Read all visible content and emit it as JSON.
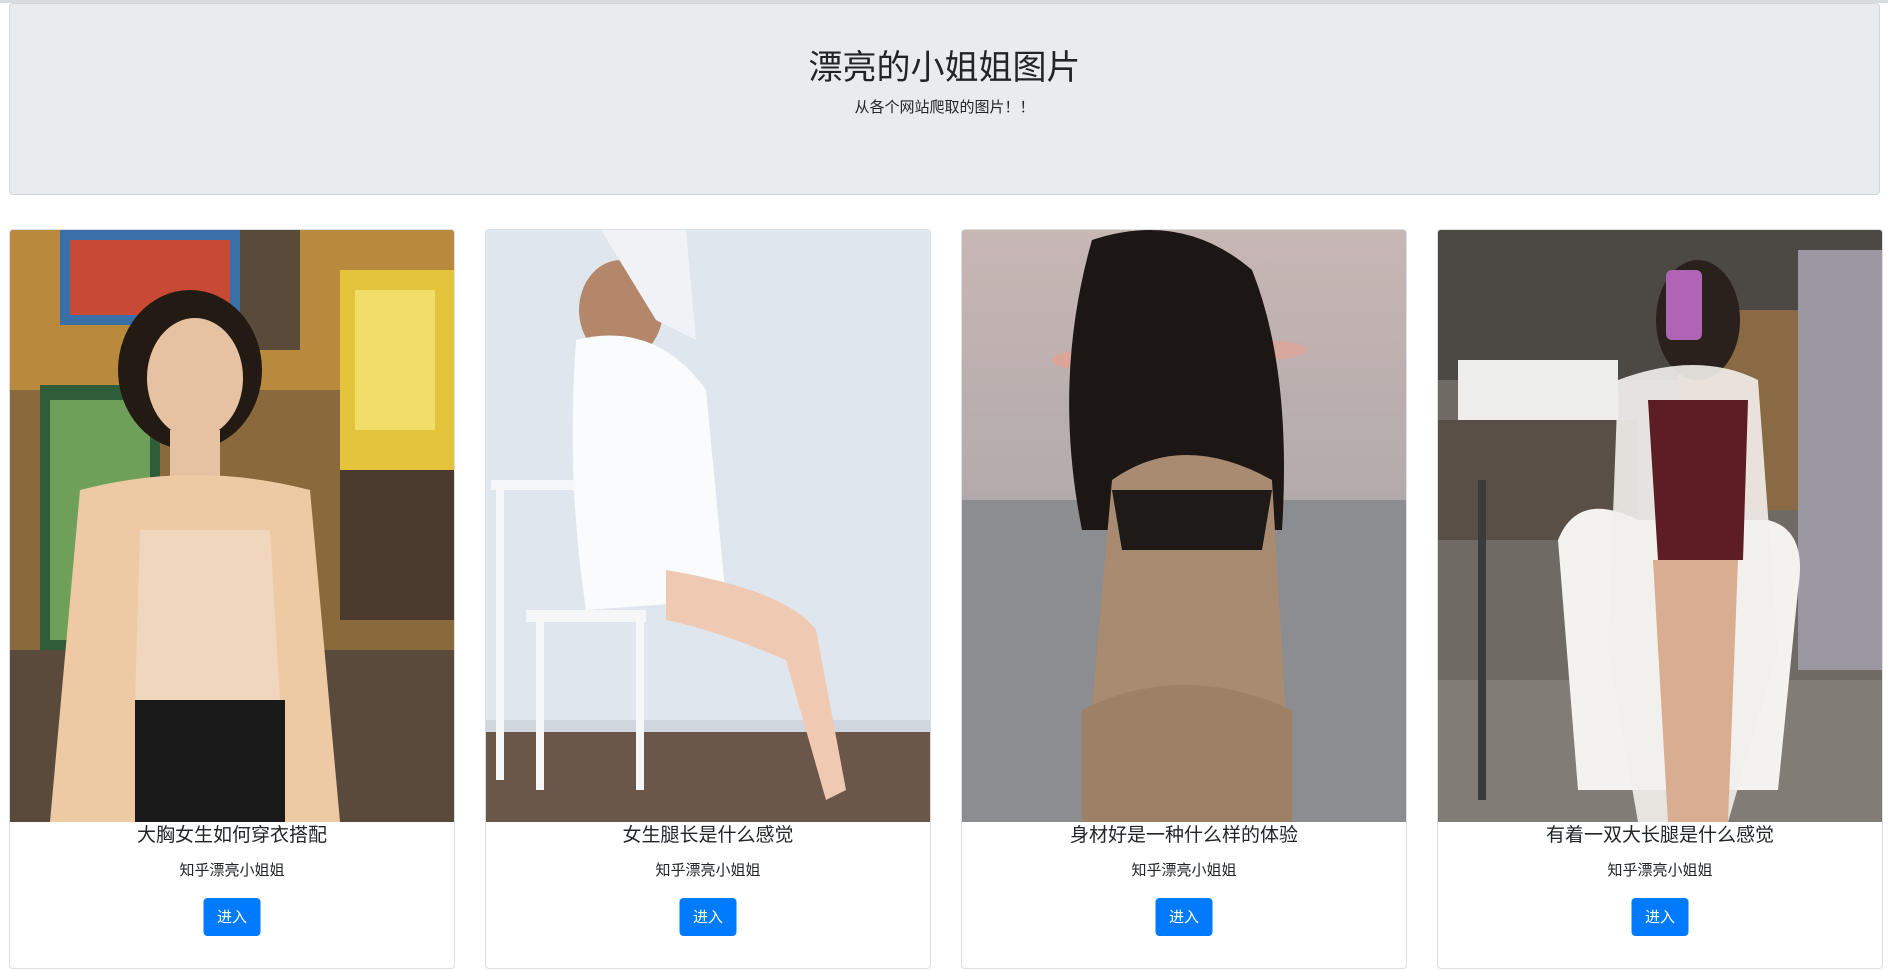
{
  "header": {
    "title": "漂亮的小姐姐图片",
    "subtitle": "从各个网站爬取的图片！！"
  },
  "cards": [
    {
      "title": "大胸女生如何穿衣搭配",
      "text": "知乎漂亮小姐姐",
      "button": "进入"
    },
    {
      "title": "女生腿长是什么感觉",
      "text": "知乎漂亮小姐姐",
      "button": "进入"
    },
    {
      "title": "身材好是一种什么样的体验",
      "text": "知乎漂亮小姐姐",
      "button": "进入"
    },
    {
      "title": "有着一双大长腿是什么感觉",
      "text": "知乎漂亮小姐姐",
      "button": "进入"
    }
  ],
  "colors": {
    "jumbotron_bg": "#e9ecef",
    "primary": "#007bff"
  }
}
